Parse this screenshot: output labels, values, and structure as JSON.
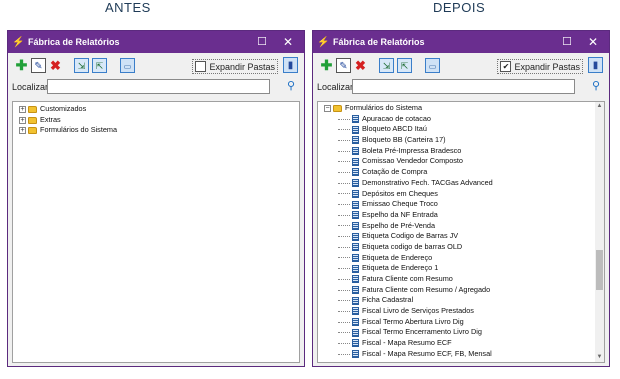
{
  "captions": {
    "left": "ANTES",
    "right": "DEPOIS"
  },
  "colors": {
    "titlebar": "#6a2e8f",
    "accent": "#1c6fc4"
  },
  "window": {
    "title": "Fábrica de Relatórios",
    "maximize_glyph": "☐",
    "close_glyph": "✕"
  },
  "toolbar": {
    "icons": [
      "add-icon",
      "edit-icon",
      "delete-icon",
      "import-icon",
      "export-icon",
      "folder-icon",
      "book-icon"
    ],
    "expand_label": "Expandir Pastas"
  },
  "search": {
    "label": "Localizar:",
    "value": ""
  },
  "left": {
    "expand_checked": false,
    "tree": [
      {
        "label": "Customizados"
      },
      {
        "label": "Extras"
      },
      {
        "label": "Formulários do Sistema"
      }
    ]
  },
  "right": {
    "expand_checked": true,
    "root": "Formulários do Sistema",
    "items": [
      "Apuracao de cotacao",
      "Bloqueto ABCD Itaú",
      "Bloqueto BB (Carteira 17)",
      "Boleta Pré-Impressa Bradesco",
      "Comissao Vendedor Composto",
      "Cotação  de Compra",
      "Demonstrativo Fech. TACGas Advanced",
      "Depósitos em Cheques",
      "Emissao Cheque Troco",
      "Espelho da NF Entrada",
      "Espelho de Pré-Venda",
      "Etiqueta Codigo de Barras JV",
      "Etiqueta codigo de  barras OLD",
      "Etiqueta de Endereço",
      "Etiqueta de Endereço 1",
      "Fatura Cliente com Resumo",
      "Fatura Cliente com Resumo / Agregado",
      "Ficha Cadastral",
      "Fiscal  Livro de Serviços Prestados",
      "Fiscal  Termo Abertura Livro Dig",
      "Fiscal  Termo Encerramento Livro Dig",
      "Fiscal - Mapa Resumo ECF",
      "Fiscal - Mapa Resumo ECF, FB, Mensal"
    ]
  }
}
